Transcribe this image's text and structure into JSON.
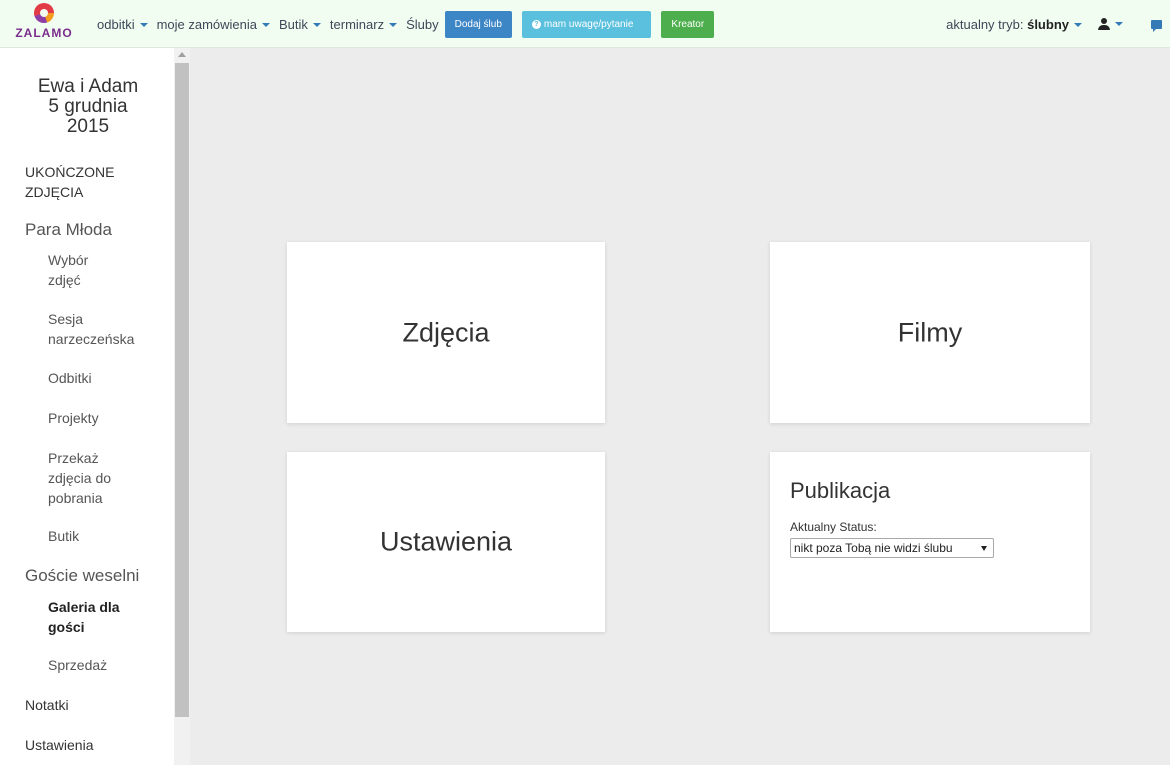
{
  "brand": {
    "name": "ZALAMO"
  },
  "nav": {
    "links": [
      {
        "label": "odbitki"
      },
      {
        "label": "moje zamówienia"
      },
      {
        "label": "Butik"
      },
      {
        "label": "terminarz"
      },
      {
        "label": "Śluby"
      }
    ],
    "buttons": {
      "add_wedding": "Dodaj ślub",
      "question": "mam uwagę/pytanie",
      "creator": "Kreator"
    },
    "mode_prefix": "aktualny tryb:",
    "mode_value": "ślubny"
  },
  "sidebar": {
    "title_line1": "Ewa i Adam",
    "title_line2": "5 grudnia",
    "title_line3": "2015",
    "completed_line1": "UKOŃCZONE",
    "completed_line2": "ZDJĘCIA",
    "section_bride_groom": "Para Młoda",
    "bride_groom_items": [
      {
        "line1": "Wybór",
        "line2": "zdjęć"
      },
      {
        "line1": "Sesja",
        "line2": "narzeczeńska"
      },
      {
        "line1": "Odbitki"
      },
      {
        "line1": "Projekty"
      },
      {
        "line1": "Przekaż",
        "line2": "zdjęcia do",
        "line3": "pobrania"
      },
      {
        "line1": "Butik"
      }
    ],
    "section_guests": "Goście weselni",
    "guest_items": [
      {
        "line1": "Galeria dla",
        "line2": "gości"
      },
      {
        "line1": "Sprzedaż"
      }
    ],
    "notes": "Notatki",
    "settings": "Ustawienia"
  },
  "cards": {
    "photos": "Zdjęcia",
    "films": "Filmy",
    "settings": "Ustawienia",
    "publication": {
      "title": "Publikacja",
      "status_label": "Aktualny Status:",
      "status_value": "nikt poza Tobą nie widzi ślubu"
    }
  },
  "colors": {
    "navbar_bg": "#f2fdf2",
    "btn_blue": "#3d86c6",
    "btn_cyan": "#5bc0de",
    "btn_green": "#4cae4c",
    "brand_purple": "#7a2d8c"
  }
}
